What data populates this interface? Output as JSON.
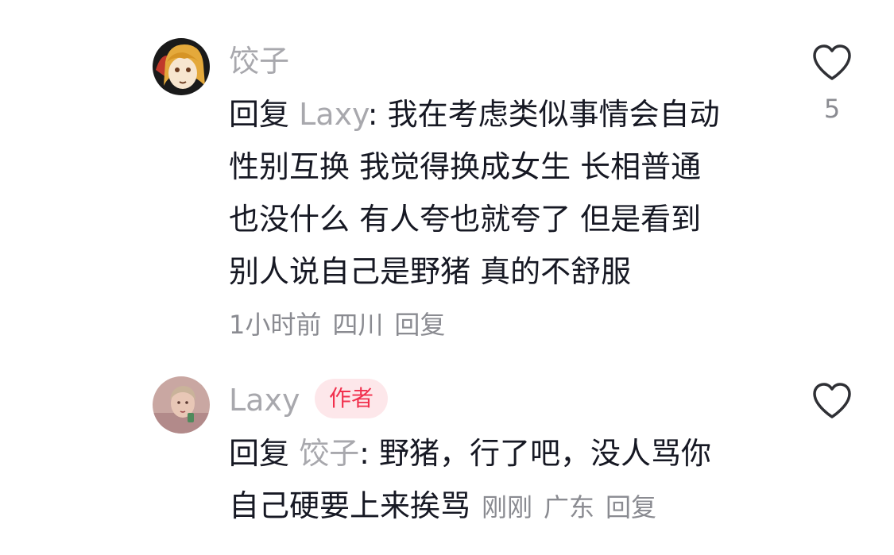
{
  "comments": [
    {
      "username": "饺子",
      "reply_prefix": "回复",
      "reply_target": "Laxy",
      "reply_sep": ": ",
      "lines": [
        "我在考虑类似事情会自动",
        "性别互换 我觉得换成女生 长相普通",
        "也没什么 有人夸也就夸了 但是看到",
        "别人说自己是野猪 真的不舒服"
      ],
      "time": "1小时前",
      "location": "四川",
      "reply_label": "回复",
      "like_count": "5",
      "like_icon": "heart-outline-icon"
    },
    {
      "username": "Laxy",
      "badge": "作者",
      "reply_prefix": "回复",
      "reply_target": "饺子",
      "reply_sep": ": ",
      "lines": [
        "野猪，行了吧，没人骂你",
        "自己硬要上来挨骂"
      ],
      "time": "刚刚",
      "location": "广东",
      "reply_label": "回复",
      "like_icon": "heart-outline-icon"
    }
  ],
  "colors": {
    "text": "#161823",
    "muted": "#a8a8ad",
    "badge_bg": "#fde7ea",
    "badge_text": "#f1304d"
  }
}
